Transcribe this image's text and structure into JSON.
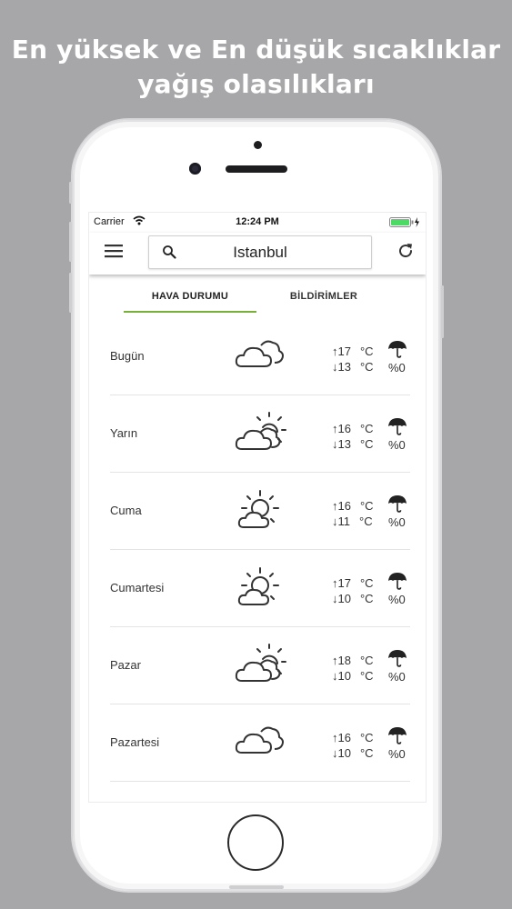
{
  "promo": {
    "line1": "En yüksek ve En düşük sıcaklıklar",
    "line2": "yağış olasılıkları"
  },
  "statusbar": {
    "carrier": "Carrier",
    "time": "12:24 PM",
    "battery_color": "#4cd964"
  },
  "appbar": {
    "city": "Istanbul",
    "icons": [
      "hamburger-menu-icon",
      "search-icon",
      "refresh-icon"
    ]
  },
  "tabs": {
    "active": "HAVA DURUMU",
    "inactive": "BİLDİRİMLER",
    "accent_color": "#78b03b"
  },
  "forecast": [
    {
      "day": "Bugün",
      "icon": "cloudy-icon",
      "high": "↑17",
      "low": "↓13",
      "unit": "°C",
      "rain": "%0"
    },
    {
      "day": "Yarın",
      "icon": "partly-cloudy-icon",
      "high": "↑16",
      "low": "↓13",
      "unit": "°C",
      "rain": "%0"
    },
    {
      "day": "Cuma",
      "icon": "sun-behind-cloud-icon",
      "high": "↑16",
      "low": "↓11",
      "unit": "°C",
      "rain": "%0"
    },
    {
      "day": "Cumartesi",
      "icon": "sun-behind-cloud-icon",
      "high": "↑17",
      "low": "↓10",
      "unit": "°C",
      "rain": "%0"
    },
    {
      "day": "Pazar",
      "icon": "partly-cloudy-icon",
      "high": "↑18",
      "low": "↓10",
      "unit": "°C",
      "rain": "%0"
    },
    {
      "day": "Pazartesi",
      "icon": "cloudy-icon",
      "high": "↑16",
      "low": "↓10",
      "unit": "°C",
      "rain": "%0"
    }
  ]
}
